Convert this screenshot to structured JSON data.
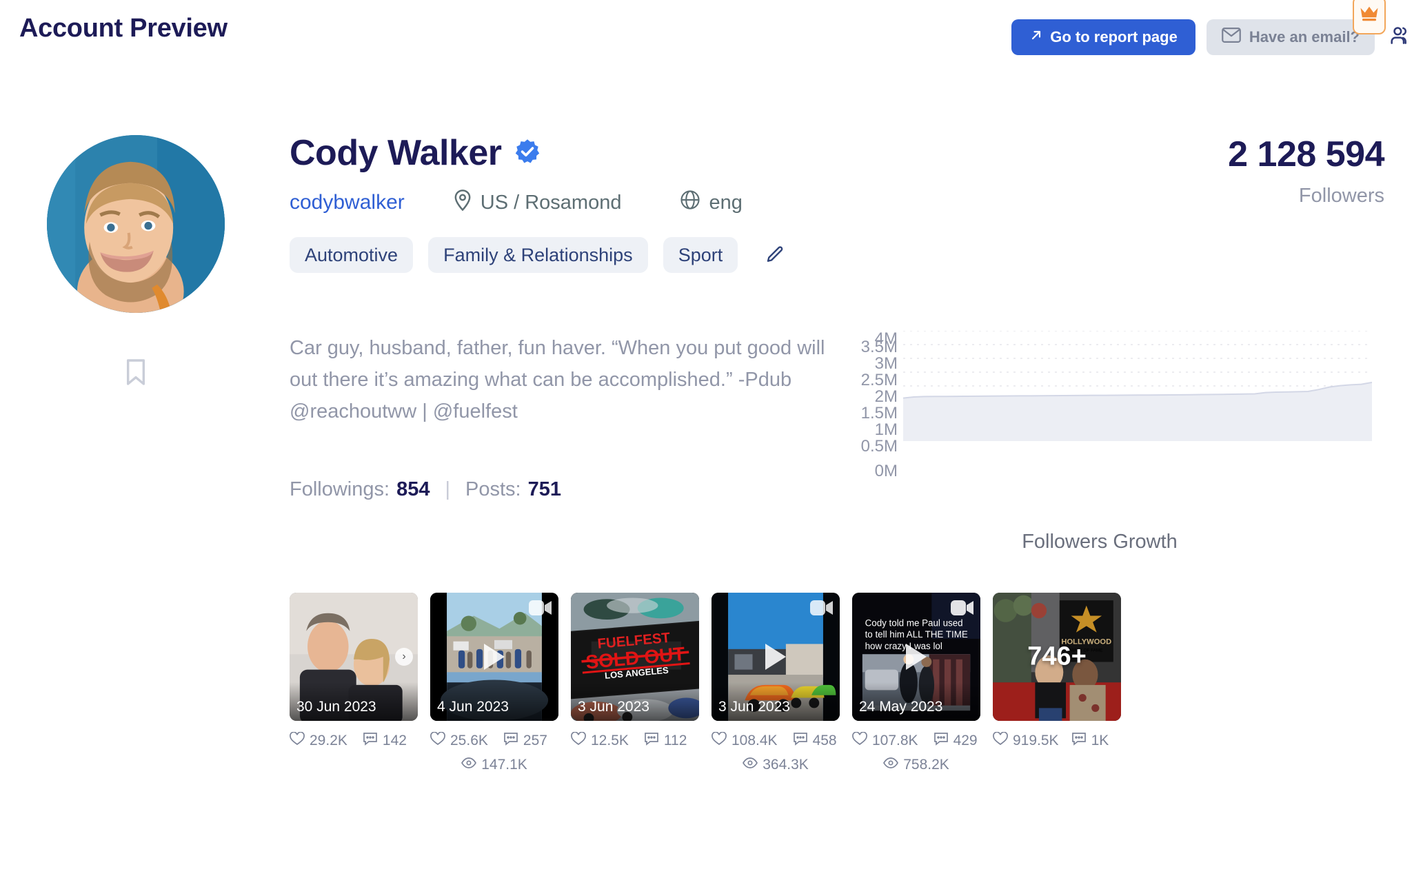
{
  "header": {
    "title": "Account Preview",
    "report_button": "Go to report page",
    "report_icon": "arrow-up-right-icon",
    "email_button": "Have an email?",
    "email_icon": "envelope-icon",
    "crown_icon": "crown-icon",
    "people_icon": "people-icon",
    "accent_blue": "#2f5fd4",
    "crown_orange": "#f08a35"
  },
  "profile": {
    "avatar_name": "profile-avatar",
    "bookmark_icon": "bookmark-icon",
    "display_name": "Cody Walker",
    "verified_icon": "verified-badge-icon",
    "handle": "codybwalker",
    "location_icon": "location-pin-icon",
    "location": "US / Rosamond",
    "language_icon": "globe-icon",
    "language": "eng",
    "tags": [
      "Automotive",
      "Family & Relationships",
      "Sport"
    ],
    "edit_icon": "pencil-icon",
    "bio": "Car guy, husband, father, fun haver. “When you put good will out there it’s amazing what can be accomplished.” -Pdub",
    "bio_links": "@reachoutww | @fuelfest",
    "followings_label": "Followings:",
    "followings_value": "854",
    "separator": "|",
    "posts_label": "Posts:",
    "posts_value": "751"
  },
  "followers": {
    "count": "2 128 594",
    "label": "Followers"
  },
  "chart_data": {
    "type": "area",
    "title": "Followers Growth",
    "xlabel": "",
    "ylabel": "",
    "ylim": [
      0,
      4000000
    ],
    "grid": true,
    "legend": "none",
    "tick_labels": [
      "4M",
      "3.5M",
      "3M",
      "2.5M",
      "2M",
      "1.5M",
      "1M",
      "0.5M",
      "0M"
    ],
    "tick_values": [
      4000000,
      3500000,
      3000000,
      2500000,
      2000000,
      1500000,
      1000000,
      500000,
      0
    ],
    "series": [
      {
        "name": "Followers",
        "values": [
          1560000,
          1600000,
          1615000,
          1618000,
          1620000,
          1622000,
          1625000,
          1628000,
          1632000,
          1635000,
          1638000,
          1640000,
          1642000,
          1645000,
          1648000,
          1650000,
          1652000,
          1655000,
          1658000,
          1660000,
          1662000,
          1665000,
          1668000,
          1670000,
          1672000,
          1675000,
          1678000,
          1682000,
          1686000,
          1690000,
          1695000,
          1700000,
          1705000,
          1712000,
          1760000,
          1775000,
          1782000,
          1790000,
          1800000,
          1870000,
          1960000,
          2010000,
          2040000,
          2060000,
          2128594
        ]
      }
    ]
  },
  "posts": [
    {
      "name": "post-1",
      "date": "30 Jun 2023",
      "media_type": "carousel",
      "likes": "29.2K",
      "comments": "142",
      "views": null
    },
    {
      "name": "post-2",
      "date": "4 Jun 2023",
      "media_type": "video",
      "likes": "25.6K",
      "comments": "257",
      "views": "147.1K"
    },
    {
      "name": "post-3",
      "date": "3 Jun 2023",
      "media_type": "image",
      "likes": "12.5K",
      "comments": "112",
      "views": null
    },
    {
      "name": "post-4",
      "date": "3 Jun 2023",
      "media_type": "video",
      "likes": "108.4K",
      "comments": "458",
      "views": "364.3K"
    },
    {
      "name": "post-5",
      "date": "24 May 2023",
      "media_type": "video",
      "likes": "107.8K",
      "comments": "429",
      "views": "758.2K",
      "caption": "Cody told me Paul used to tell him ALL THE TIME how crazy I was lol"
    },
    {
      "name": "post-6",
      "date": "",
      "media_type": "more",
      "overlay": "746+",
      "likes": "919.5K",
      "comments": "1K",
      "views": null
    }
  ],
  "icons": {
    "heart": "heart-icon",
    "comment": "comment-icon",
    "eye": "eye-icon"
  }
}
